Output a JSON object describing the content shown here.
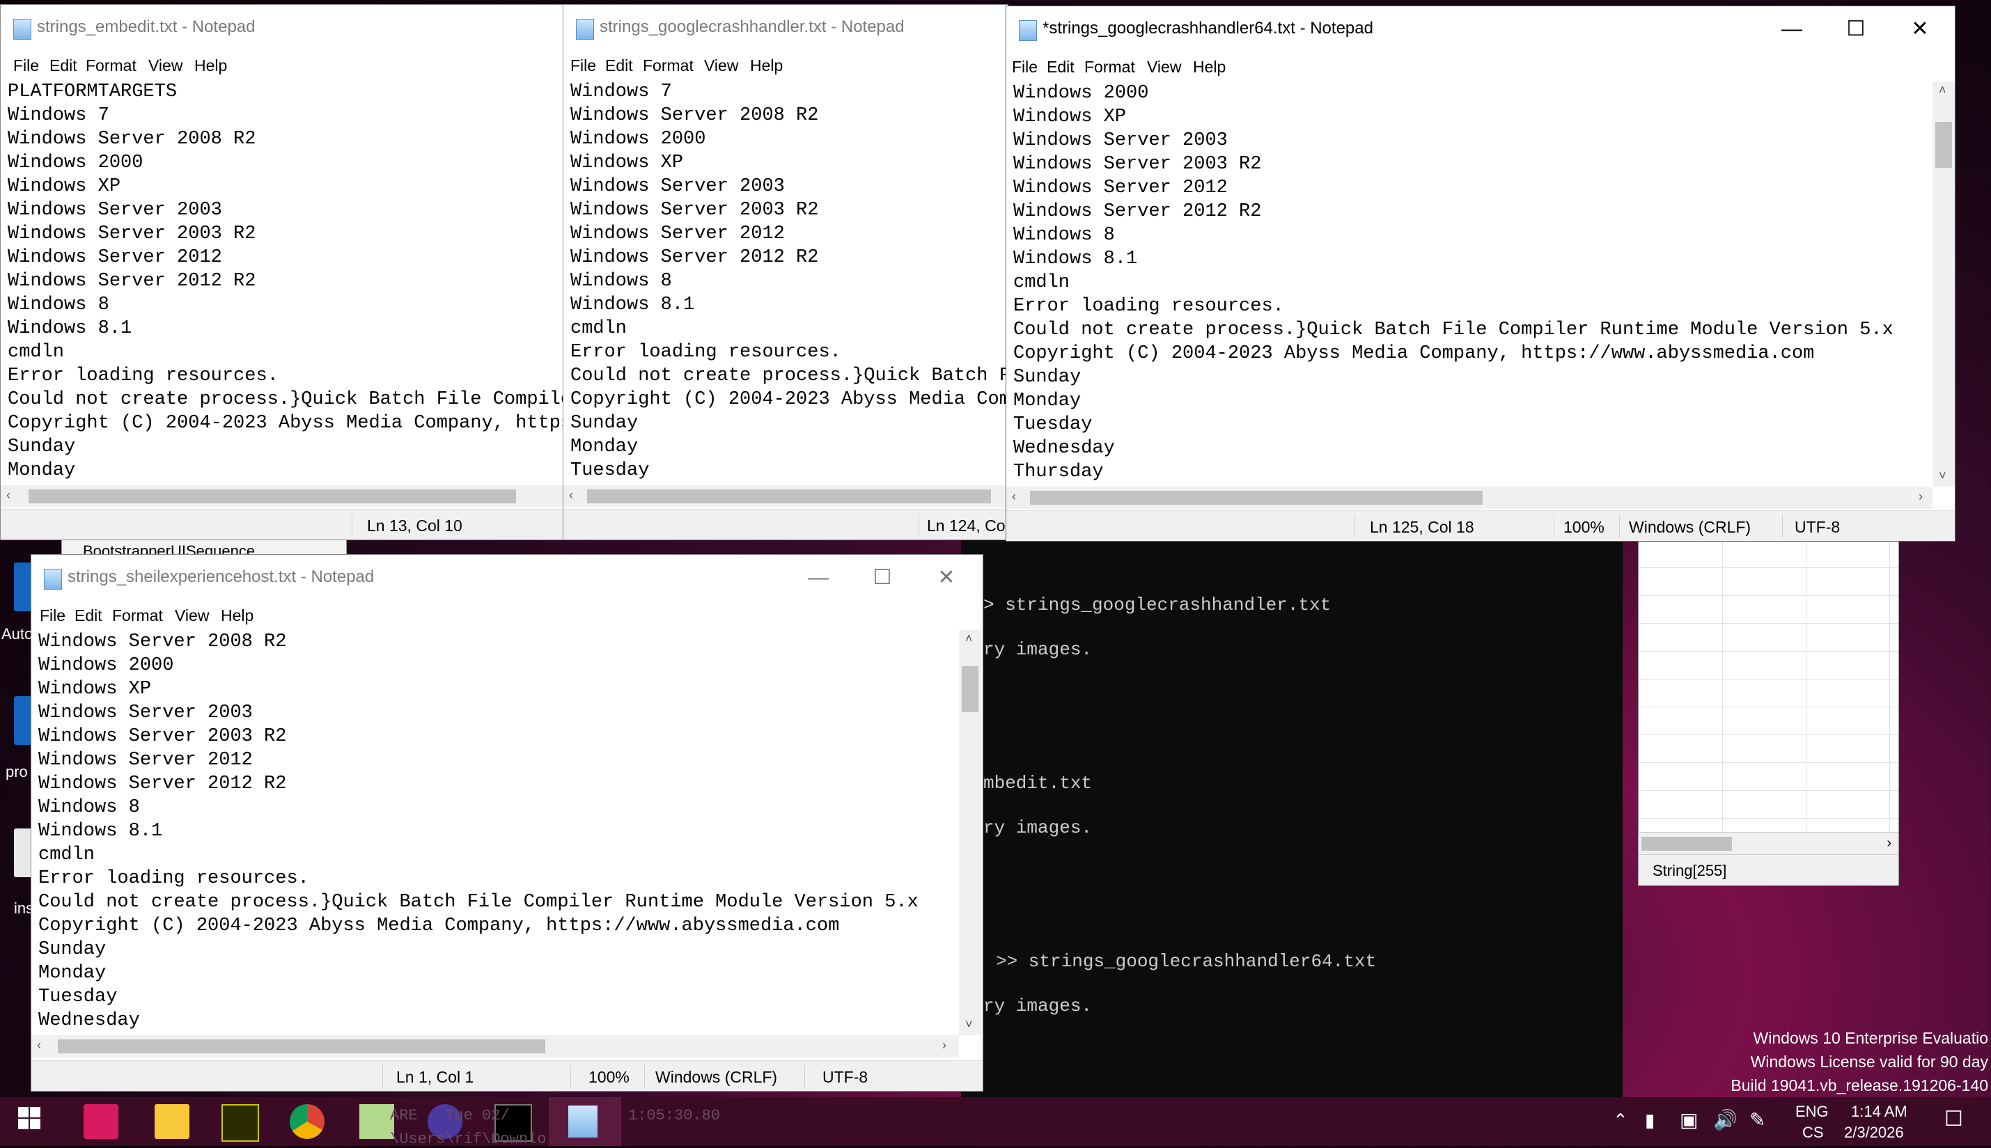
{
  "desktop": {
    "icon_labels": [
      "Auto",
      "pro",
      "ins"
    ]
  },
  "background_window": {
    "title": "BootstrapperUISequence"
  },
  "console": {
    "lines": [
      "> strings_googlecrashhandler.txt",
      "ry images.",
      "mbedit.txt",
      "ry images.",
      ">> strings_googlecrashhandler64.txt",
      "ry images."
    ]
  },
  "sheet": {
    "status_text": "String[255]"
  },
  "notepad_embedit": {
    "title": "strings_embedit.txt - Notepad",
    "menu": [
      "File",
      "Edit",
      "Format",
      "View",
      "Help"
    ],
    "lines": [
      "PLATFORMTARGETS",
      "Windows 7",
      "Windows Server 2008 R2",
      "Windows 2000",
      "Windows XP",
      "Windows Server 2003",
      "Windows Server 2003 R2",
      "Windows Server 2012",
      "Windows Server 2012 R2",
      "Windows 8",
      "Windows 8.1",
      "cmdln",
      "Error loading resources.",
      "Could not create process.}Quick Batch File Compile",
      "Copyright (C) 2004-2023 Abyss Media Company, https",
      "Sunday",
      "Monday"
    ],
    "status_position": "Ln 13, Col 10"
  },
  "notepad_googlecrash": {
    "title": "strings_googlecrashhandler.txt - Notepad",
    "menu": [
      "File",
      "Edit",
      "Format",
      "View",
      "Help"
    ],
    "lines": [
      "Windows 7",
      "Windows Server 2008 R2",
      "Windows 2000",
      "Windows XP",
      "Windows Server 2003",
      "Windows Server 2003 R2",
      "Windows Server 2012",
      "Windows Server 2012 R2",
      "Windows 8",
      "Windows 8.1",
      "cmdln",
      "Error loading resources.",
      "Could not create process.}Quick Batch F",
      "Copyright (C) 2004-2023 Abyss Media Com",
      "Sunday",
      "Monday",
      "Tuesday"
    ],
    "status_position": "Ln 124, Col"
  },
  "notepad_googlecrash64": {
    "title": "*strings_googlecrashhandler64.txt - Notepad",
    "menu": [
      "File",
      "Edit",
      "Format",
      "View",
      "Help"
    ],
    "lines": [
      "Windows 2000",
      "Windows XP",
      "Windows Server 2003",
      "Windows Server 2003 R2",
      "Windows Server 2012",
      "Windows Server 2012 R2",
      "Windows 8",
      "Windows 8.1",
      "cmdln",
      "Error loading resources.",
      "Could not create process.}Quick Batch File Compiler Runtime Module Version 5.x",
      "Copyright (C) 2004-2023 Abyss Media Company, https://www.abyssmedia.com",
      "Sunday",
      "Monday",
      "Tuesday",
      "Wednesday",
      "Thursday"
    ],
    "status_position": "Ln 125, Col 18",
    "status_zoom": "100%",
    "status_eol": "Windows (CRLF)",
    "status_encoding": "UTF-8"
  },
  "notepad_shell": {
    "title": "strings_sheilexperiencehost.txt - Notepad",
    "menu": [
      "File",
      "Edit",
      "Format",
      "View",
      "Help"
    ],
    "lines": [
      "Windows Server 2008 R2",
      "Windows 2000",
      "Windows XP",
      "Windows Server 2003",
      "Windows Server 2003 R2",
      "Windows Server 2012",
      "Windows Server 2012 R2",
      "Windows 8",
      "Windows 8.1",
      "cmdln",
      "Error loading resources.",
      "Could not create process.}Quick Batch File Compiler Runtime Module Version 5.x",
      "Copyright (C) 2004-2023 Abyss Media Company, https://www.abyssmedia.com",
      "Sunday",
      "Monday",
      "Tuesday",
      "Wednesday"
    ],
    "status_position": "Ln 1, Col 1",
    "status_zoom": "100%",
    "status_eol": "Windows (CRLF)",
    "status_encoding": "UTF-8"
  },
  "watermark": {
    "line1": "Windows 10 Enterprise Evaluatio",
    "line2": "Windows License valid for 90 day",
    "line3": "Build 19041.vb_release.191206-140"
  },
  "taskbar": {
    "ghost_text_1": "ARE - Tue 02/",
    "ghost_text_2": "1:05:30.80",
    "ghost_text_3": "\\Users\\rif\\Downlo",
    "lang_top": "ENG",
    "lang_bottom": "CS",
    "time": "1:14 AM",
    "date": "2/3/2026"
  },
  "colors": {
    "taskbar": "#3b0b26",
    "console_bg": "#0c0c0c",
    "window_bg": "#ffffff"
  }
}
